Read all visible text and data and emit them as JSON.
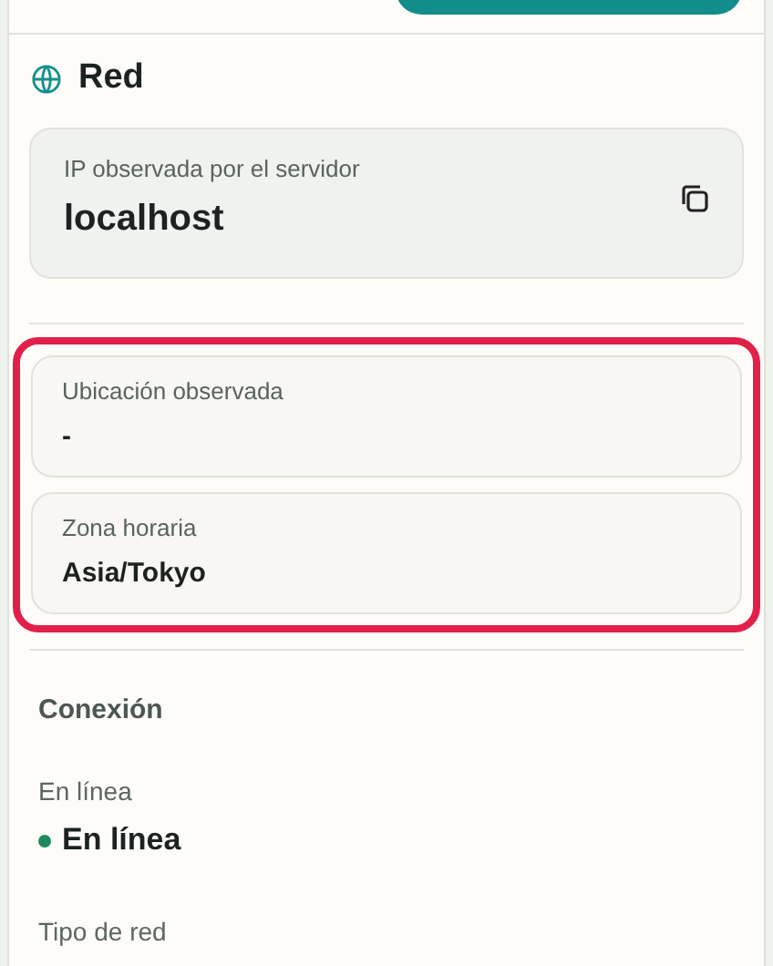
{
  "network": {
    "title": "Red",
    "server_ip": {
      "label": "IP observada por el servidor",
      "value": "localhost"
    },
    "highlighted": true,
    "fields": [
      {
        "label": "Ubicación observada",
        "value": "-"
      },
      {
        "label": "Zona horaria",
        "value": "Asia/Tokyo"
      }
    ]
  },
  "connection": {
    "title": "Conexión",
    "status": {
      "label": "En línea",
      "value": "En línea",
      "color": "#1f8a5e"
    },
    "network_type": {
      "label": "Tipo de red"
    }
  }
}
